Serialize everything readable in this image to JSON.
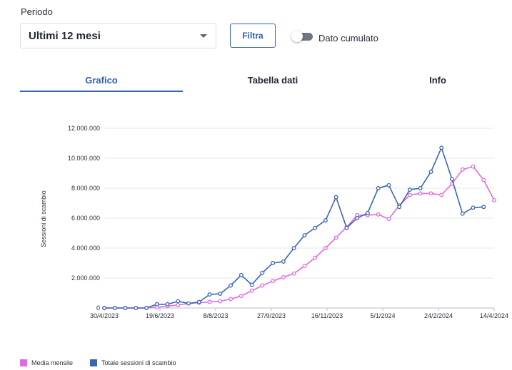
{
  "filters": {
    "period_label": "Periodo",
    "period_value": "Ultimi 12 mesi",
    "filter_button": "Filtra",
    "cumulative_label": "Dato cumulato",
    "cumulative_on": false
  },
  "tabs": [
    {
      "label": "Grafico",
      "active": true
    },
    {
      "label": "Tabella dati",
      "active": false
    },
    {
      "label": "Info",
      "active": false
    }
  ],
  "colors": {
    "accent": "#3566b7",
    "media_mensile": "#e06be0",
    "totale": "#3a66b0"
  },
  "legend": {
    "media": "Media mensile",
    "totale": "Totale sessioni di scambio"
  },
  "chart_data": {
    "type": "line",
    "ylabel": "Sessioni di scambio",
    "xlabel": "",
    "ylim": [
      0,
      12000000
    ],
    "y_ticks": [
      "0",
      "2.000.000",
      "4.000.000",
      "6.000.000",
      "8.000.000",
      "10.000.000",
      "12.000.000"
    ],
    "x_tick_labels": [
      "30/4/2023",
      "19/6/2023",
      "8/8/2023",
      "27/9/2023",
      "16/11/2023",
      "5/1/2024",
      "24/2/2024",
      "14/4/2024"
    ],
    "grid": "horizontal",
    "legend_position": "bottom-left",
    "series": [
      {
        "name": "Media mensile",
        "values": [
          0,
          0,
          0,
          0,
          0,
          50000,
          120000,
          200000,
          300000,
          350000,
          400000,
          450000,
          600000,
          800000,
          1150000,
          1500000,
          1800000,
          2050000,
          2300000,
          2800000,
          3350000,
          4000000,
          4700000,
          5400000,
          6200000,
          6200000,
          6250000,
          5950000,
          6850000,
          7550000,
          7650000,
          7650000,
          7550000,
          8300000,
          9250000,
          9450000,
          8550000,
          7200000
        ]
      },
      {
        "name": "Totale sessioni di scambio",
        "values": [
          0,
          0,
          0,
          0,
          0,
          250000,
          250000,
          450000,
          300000,
          400000,
          900000,
          950000,
          1500000,
          2200000,
          1550000,
          2350000,
          3000000,
          3100000,
          4000000,
          4850000,
          5350000,
          5850000,
          7400000,
          5350000,
          6000000,
          6350000,
          8000000,
          8200000,
          6750000,
          7900000,
          8000000,
          9100000,
          10700000,
          8600000,
          6300000,
          6700000,
          6750000
        ]
      }
    ]
  }
}
